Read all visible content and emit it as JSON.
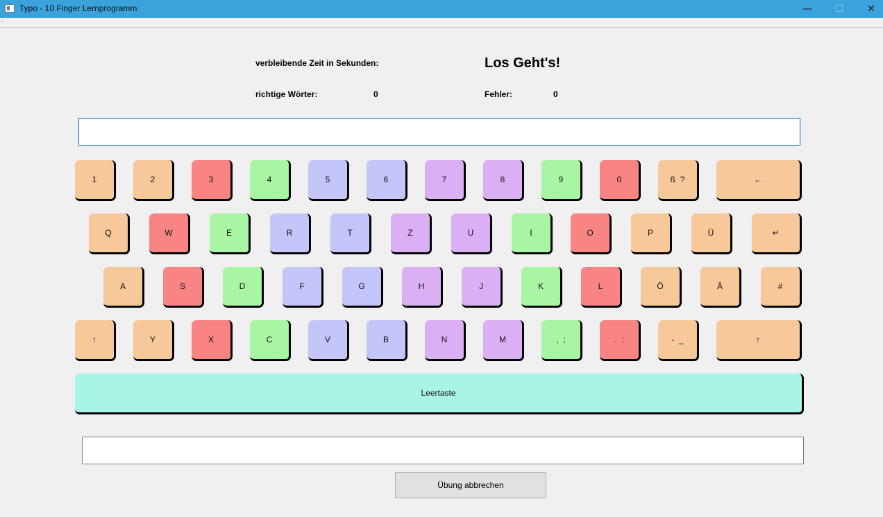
{
  "window": {
    "title": "Typo - 10 Finger Lernprogramm",
    "minimize_glyph": "—",
    "maximize_glyph": "☐",
    "close_glyph": "✕"
  },
  "stats": {
    "time_label": "verbleibende Zeit in Sekunden:",
    "headline": "Los Geht's!",
    "correct_words_label": "richtige Wörter:",
    "correct_words_value": "0",
    "errors_label": "Fehler:",
    "errors_value": "0"
  },
  "target_text": "",
  "input_text": "",
  "keyboard": {
    "colors": {
      "orange": "#f7c99a",
      "red": "#f98484",
      "green": "#a8f5a3",
      "blue": "#c4c6f9",
      "purple": "#dbaff4",
      "space": "#a9f5e5"
    },
    "row1": [
      {
        "label": "1",
        "color": "orange"
      },
      {
        "label": "2",
        "color": "orange"
      },
      {
        "label": "3",
        "color": "red"
      },
      {
        "label": "4",
        "color": "green"
      },
      {
        "label": "5",
        "color": "blue"
      },
      {
        "label": "6",
        "color": "blue"
      },
      {
        "label": "7",
        "color": "purple"
      },
      {
        "label": "8",
        "color": "purple"
      },
      {
        "label": "9",
        "color": "green"
      },
      {
        "label": "0",
        "color": "red"
      },
      {
        "label": "ß  ?",
        "color": "orange"
      },
      {
        "label": "←",
        "color": "orange"
      }
    ],
    "row2": [
      {
        "label": "Q",
        "color": "orange"
      },
      {
        "label": "W",
        "color": "red"
      },
      {
        "label": "E",
        "color": "green"
      },
      {
        "label": "R",
        "color": "blue"
      },
      {
        "label": "T",
        "color": "blue"
      },
      {
        "label": "Z",
        "color": "purple"
      },
      {
        "label": "U",
        "color": "purple"
      },
      {
        "label": "I",
        "color": "green"
      },
      {
        "label": "O",
        "color": "red"
      },
      {
        "label": "P",
        "color": "orange"
      },
      {
        "label": "Ü",
        "color": "orange"
      },
      {
        "label": "↵",
        "color": "orange"
      }
    ],
    "row3": [
      {
        "label": "A",
        "color": "orange"
      },
      {
        "label": "S",
        "color": "red"
      },
      {
        "label": "D",
        "color": "green"
      },
      {
        "label": "F",
        "color": "blue"
      },
      {
        "label": "G",
        "color": "blue"
      },
      {
        "label": "H",
        "color": "purple"
      },
      {
        "label": "J",
        "color": "purple"
      },
      {
        "label": "K",
        "color": "green"
      },
      {
        "label": "L",
        "color": "red"
      },
      {
        "label": "Ö",
        "color": "orange"
      },
      {
        "label": "Ä",
        "color": "orange"
      },
      {
        "label": "#",
        "color": "orange"
      }
    ],
    "row4": [
      {
        "label": "↑",
        "color": "orange"
      },
      {
        "label": "Y",
        "color": "orange"
      },
      {
        "label": "X",
        "color": "red"
      },
      {
        "label": "C",
        "color": "green"
      },
      {
        "label": "V",
        "color": "blue"
      },
      {
        "label": "B",
        "color": "blue"
      },
      {
        "label": "N",
        "color": "purple"
      },
      {
        "label": "M",
        "color": "purple"
      },
      {
        "label": ",  ;",
        "color": "green"
      },
      {
        "label": ".  :",
        "color": "red"
      },
      {
        "label": "-  _",
        "color": "orange"
      },
      {
        "label": "↑",
        "color": "orange"
      }
    ],
    "space_label": "Leertaste"
  },
  "buttons": {
    "cancel_label": "Übung abbrechen"
  }
}
